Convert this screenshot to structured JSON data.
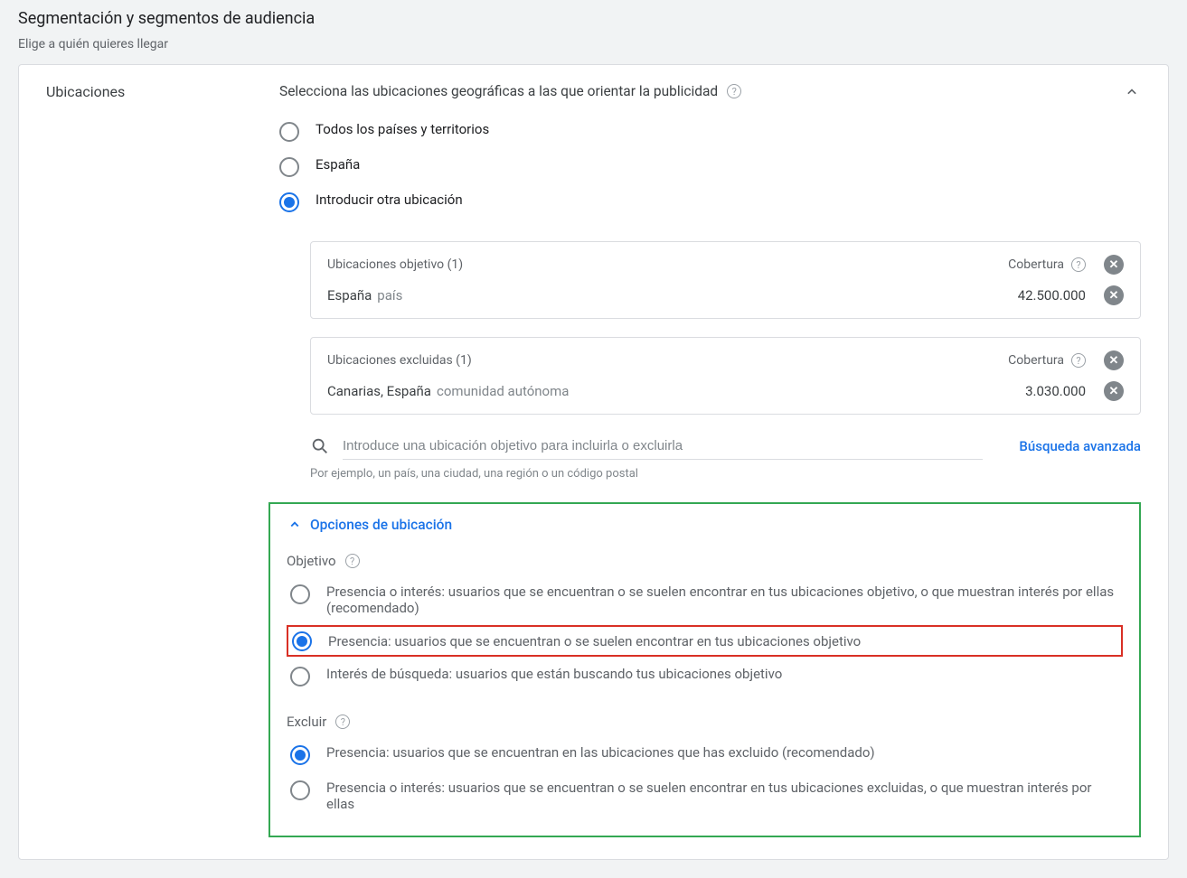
{
  "header": {
    "title": "Segmentación y segmentos de audiencia",
    "subtitle": "Elige a quién quieres llegar"
  },
  "locations": {
    "section_title": "Ubicaciones",
    "description": "Selecciona las ubicaciones geográficas a las que orientar la publicidad",
    "radios": [
      {
        "label": "Todos los países y territorios",
        "selected": false
      },
      {
        "label": "España",
        "selected": false
      },
      {
        "label": "Introducir otra ubicación",
        "selected": true
      }
    ],
    "target_box": {
      "title": "Ubicaciones objetivo (1)",
      "coverage_label": "Cobertura",
      "items": [
        {
          "name": "España",
          "type": "país",
          "value": "42.500.000"
        }
      ]
    },
    "excluded_box": {
      "title": "Ubicaciones excluidas (1)",
      "coverage_label": "Cobertura",
      "items": [
        {
          "name": "Canarias, España",
          "type": "comunidad autónoma",
          "value": "3.030.000"
        }
      ]
    },
    "search": {
      "placeholder": "Introduce una ubicación objetivo para incluirla o excluirla",
      "advanced_link": "Búsqueda avanzada",
      "example": "Por ejemplo, un país, una ciudad, una región o un código postal"
    },
    "options": {
      "expand_label": "Opciones de ubicación",
      "target": {
        "label": "Objetivo",
        "radios": [
          {
            "label": "Presencia o interés: usuarios que se encuentran o se suelen encontrar en tus ubicaciones objetivo, o que muestran interés por ellas (recomendado)",
            "selected": false
          },
          {
            "label": "Presencia: usuarios que se encuentran o se suelen encontrar en tus ubicaciones objetivo",
            "selected": true
          },
          {
            "label": "Interés de búsqueda: usuarios que están buscando tus ubicaciones objetivo",
            "selected": false
          }
        ]
      },
      "exclude": {
        "label": "Excluir",
        "radios": [
          {
            "label": "Presencia: usuarios que se encuentran en las ubicaciones que has excluido (recomendado)",
            "selected": true
          },
          {
            "label": "Presencia o interés: usuarios que se encuentran o se suelen encontrar en tus ubicaciones excluidas, o que muestran interés por ellas",
            "selected": false
          }
        ]
      }
    }
  }
}
